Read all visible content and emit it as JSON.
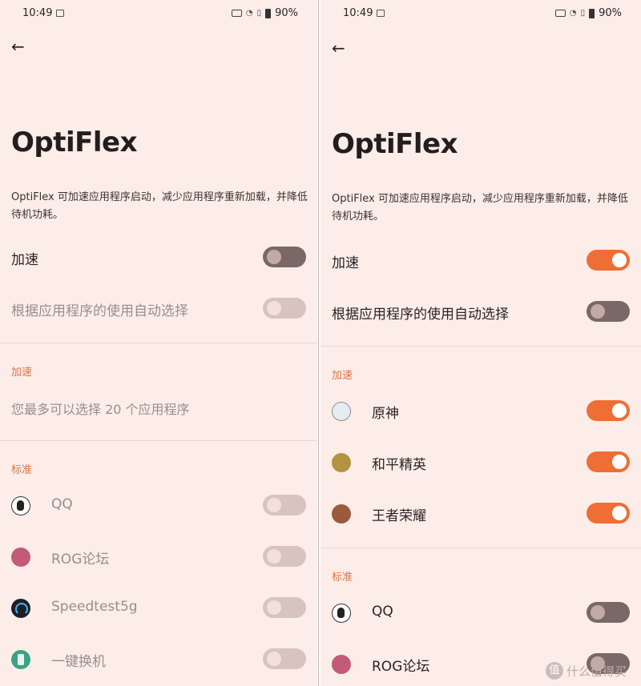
{
  "status": {
    "time": "10:49",
    "battery": "90%"
  },
  "left": {
    "title": "OptiFlex",
    "description": "OptiFlex 可加速应用程序启动，减少应用程序重新加载，并降低待机功耗。",
    "boost_label": "加速",
    "auto_label": "根据应用程序的使用自动选择",
    "section_boost": "加速",
    "hint": "您最多可以选择 20 个应用程序",
    "section_standard": "标准",
    "apps": [
      {
        "name": "QQ",
        "icon": "qq-icon",
        "state": "disabled"
      },
      {
        "name": "ROG论坛",
        "icon": "rog-icon",
        "state": "disabled"
      },
      {
        "name": "Speedtest5g",
        "icon": "speedtest-icon",
        "state": "disabled"
      },
      {
        "name": "一键换机",
        "icon": "phone-clone-icon",
        "state": "disabled"
      }
    ],
    "boost_state": "off",
    "auto_state": "disabled"
  },
  "right": {
    "title": "OptiFlex",
    "description": "OptiFlex 可加速应用程序启动，减少应用程序重新加载，并降低待机功耗。",
    "boost_label": "加速",
    "auto_label": "根据应用程序的使用自动选择",
    "section_boost": "加速",
    "boost_apps": [
      {
        "name": "原神",
        "icon": "genshin-icon",
        "state": "on"
      },
      {
        "name": "和平精英",
        "icon": "peacekeeper-elite-icon",
        "state": "on"
      },
      {
        "name": "王者荣耀",
        "icon": "honor-of-kings-icon",
        "state": "on"
      }
    ],
    "section_standard": "标准",
    "standard_apps": [
      {
        "name": "QQ",
        "icon": "qq-icon",
        "state": "off"
      },
      {
        "name": "ROG论坛",
        "icon": "rog-icon",
        "state": "off"
      }
    ],
    "boost_state": "on",
    "auto_state": "off"
  },
  "watermark": "值 什么值得买"
}
